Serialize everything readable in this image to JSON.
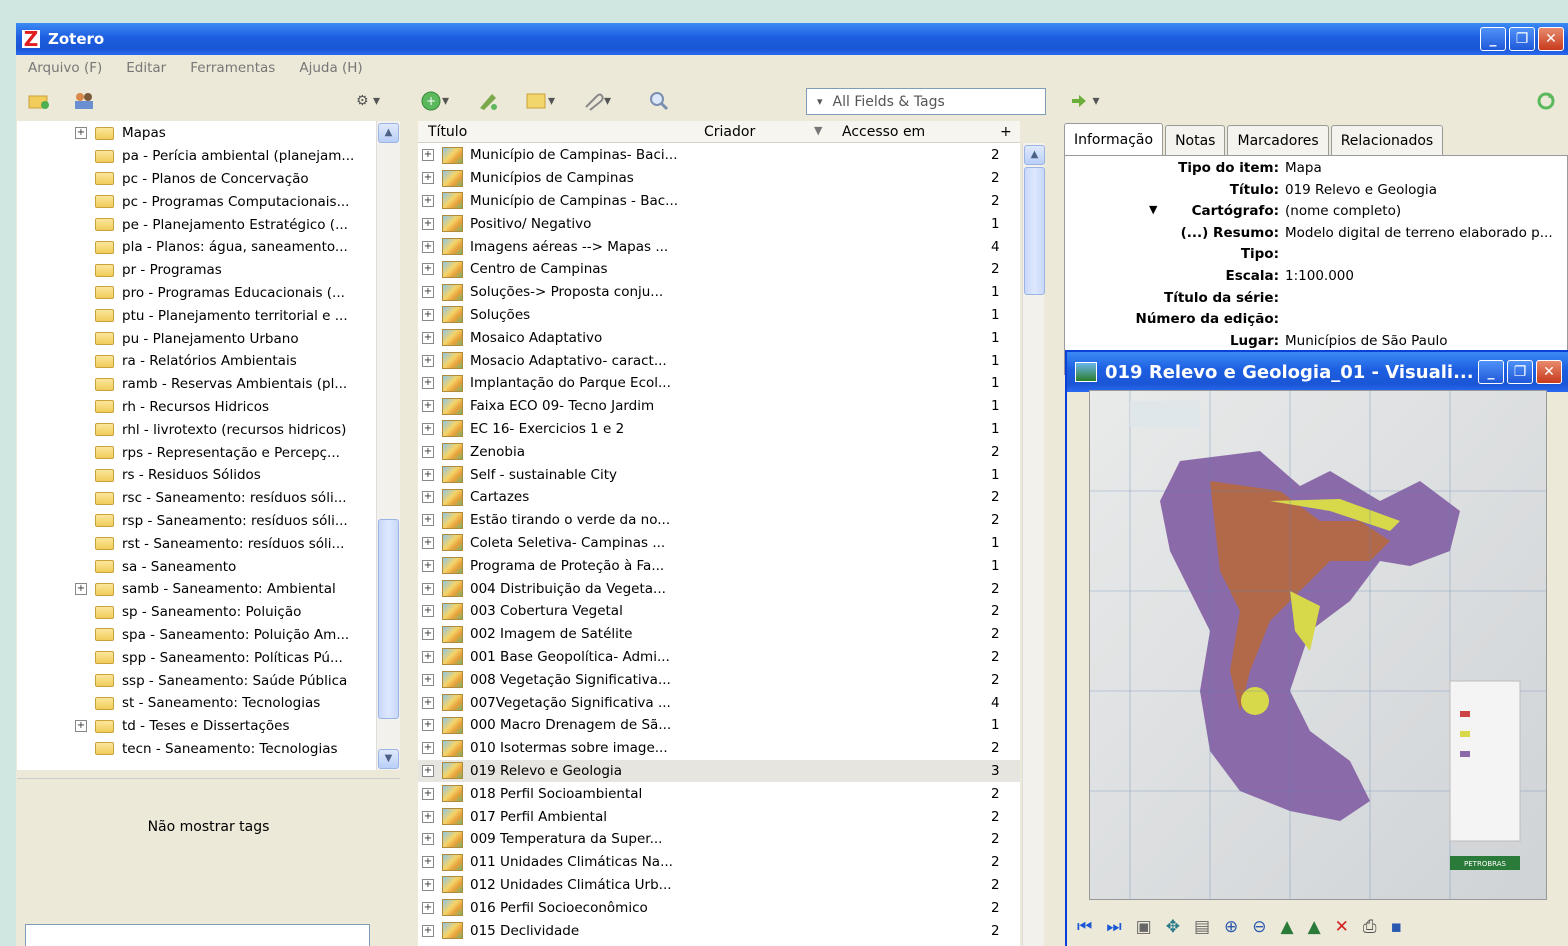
{
  "window": {
    "title": "Zotero",
    "controls": {
      "minimize": "_",
      "restore": "❐",
      "close": "✕"
    }
  },
  "menu": [
    {
      "label": "Arquivo (F)"
    },
    {
      "label": "Editar"
    },
    {
      "label": "Ferramentas"
    },
    {
      "label": "Ajuda (H)"
    }
  ],
  "toolbar": {
    "search_placeholder": "All Fields & Tags",
    "search_mode_arrow": "▾"
  },
  "collections": [
    {
      "label": "Mapas",
      "expandable": true
    },
    {
      "label": "pa - Perícia ambiental (planejam..."
    },
    {
      "label": "pc - Planos de Concervação"
    },
    {
      "label": "pc - Programas Computacionais..."
    },
    {
      "label": "pe - Planejamento Estratégico (..."
    },
    {
      "label": "pla - Planos: água, saneamento..."
    },
    {
      "label": "pr - Programas"
    },
    {
      "label": "pro - Programas Educacionais (..."
    },
    {
      "label": "ptu - Planejamento territorial e ..."
    },
    {
      "label": "pu - Planejamento Urbano"
    },
    {
      "label": "ra - Relatórios Ambientais"
    },
    {
      "label": "ramb - Reservas Ambientais (pl..."
    },
    {
      "label": "rh - Recursos Hidricos"
    },
    {
      "label": "rhl - livrotexto (recursos hidricos)"
    },
    {
      "label": "rps - Representação e Percepç..."
    },
    {
      "label": "rs - Residuos Sólidos"
    },
    {
      "label": "rsc - Saneamento: resíduos sóli..."
    },
    {
      "label": "rsp - Saneamento: resíduos sóli..."
    },
    {
      "label": "rst - Saneamento: resíduos sóli..."
    },
    {
      "label": "sa - Saneamento"
    },
    {
      "label": "samb - Saneamento: Ambiental",
      "expandable": true
    },
    {
      "label": "sp - Saneamento: Poluição"
    },
    {
      "label": "spa - Saneamento: Poluição Am..."
    },
    {
      "label": "spp - Saneamento: Políticas Pú..."
    },
    {
      "label": "ssp - Saneamento: Saúde Pública"
    },
    {
      "label": "st - Saneamento: Tecnologias"
    },
    {
      "label": "td - Teses e Dissertações",
      "expandable": true
    },
    {
      "label": "tecn - Saneamento: Tecnologias"
    }
  ],
  "tags": {
    "message": "Não mostrar tags"
  },
  "items_columns": {
    "title": "Título",
    "creator": "Criador",
    "accessed": "Accesso em",
    "add": "+"
  },
  "items": [
    {
      "title": "Município de Campinas- Baci...",
      "count": "2"
    },
    {
      "title": "Municípios de Campinas",
      "count": "2"
    },
    {
      "title": "Município de Campinas - Bac...",
      "count": "2"
    },
    {
      "title": "Positivo/ Negativo",
      "count": "1"
    },
    {
      "title": "Imagens aéreas --> Mapas ...",
      "count": "4"
    },
    {
      "title": "Centro de Campinas",
      "count": "2"
    },
    {
      "title": "Soluções-> Proposta conju...",
      "count": "1"
    },
    {
      "title": "Soluções",
      "count": "1"
    },
    {
      "title": "Mosaico Adaptativo",
      "count": "1"
    },
    {
      "title": "Mosacio Adaptativo- caract...",
      "count": "1"
    },
    {
      "title": "Implantação do Parque Ecol...",
      "count": "1"
    },
    {
      "title": "Faixa ECO 09- Tecno Jardim",
      "count": "1"
    },
    {
      "title": "EC 16- Exercicios 1 e 2",
      "count": "1"
    },
    {
      "title": "Zenobia",
      "count": "2"
    },
    {
      "title": "Self - sustainable City",
      "count": "1"
    },
    {
      "title": "Cartazes",
      "count": "2"
    },
    {
      "title": "Estão tirando o verde da no...",
      "count": "2"
    },
    {
      "title": "Coleta Seletiva- Campinas ...",
      "count": "1"
    },
    {
      "title": "Programa  de Proteção à Fa...",
      "count": "1"
    },
    {
      "title": "004 Distribuição  da Vegeta...",
      "count": "2"
    },
    {
      "title": "003 Cobertura Vegetal",
      "count": "2"
    },
    {
      "title": "002 Imagem de Satélite",
      "count": "2"
    },
    {
      "title": "001 Base Geopolítica- Admi...",
      "count": "2"
    },
    {
      "title": "008 Vegetação Significativa...",
      "count": "2"
    },
    {
      "title": "007Vegetação Significativa ...",
      "count": "4"
    },
    {
      "title": "000 Macro Drenagem de Sã...",
      "count": "1"
    },
    {
      "title": "010 Isotermas sobre image...",
      "count": "2"
    },
    {
      "title": "019 Relevo e Geologia",
      "count": "3",
      "selected": true
    },
    {
      "title": "018 Perfil Socioambiental",
      "count": "2"
    },
    {
      "title": "017 Perfil Ambiental",
      "count": "2"
    },
    {
      "title": "009 Temperatura  da Super...",
      "count": "2"
    },
    {
      "title": "011 Unidades Climáticas Na...",
      "count": "2"
    },
    {
      "title": "012 Unidades Climática Urb...",
      "count": "2"
    },
    {
      "title": "016 Perfil Socioeconômico",
      "count": "2"
    },
    {
      "title": "015 Declividade",
      "count": "2"
    }
  ],
  "tabs": [
    {
      "label": "Informação",
      "active": true
    },
    {
      "label": "Notas"
    },
    {
      "label": "Marcadores"
    },
    {
      "label": "Relacionados"
    }
  ],
  "fields": [
    {
      "label": "Tipo do item:",
      "value": "Mapa"
    },
    {
      "label": "Título:",
      "value": "019 Relevo e Geologia"
    },
    {
      "label": "Cartógrafo:",
      "value": "(nome completo)",
      "arrow": "▼"
    },
    {
      "label": "(...) Resumo:",
      "value": "Modelo digital de terreno elaborado p..."
    },
    {
      "label": "Tipo:",
      "value": ""
    },
    {
      "label": "Escala:",
      "value": "1:100.000"
    },
    {
      "label": "Título da série:",
      "value": ""
    },
    {
      "label": "Número da edição:",
      "value": ""
    },
    {
      "label": "Lugar:",
      "value": "Municípios de São Paulo"
    }
  ],
  "viewer": {
    "title": "019 Relevo e Geologia_01 - Visuali...",
    "photo_label": "PETROBRAS"
  },
  "colors": {
    "titlebar": "#1c5ee0",
    "selection": "#e6e5e0",
    "map_purple": "#8a6aa8",
    "map_yellow": "#d7d84a"
  }
}
